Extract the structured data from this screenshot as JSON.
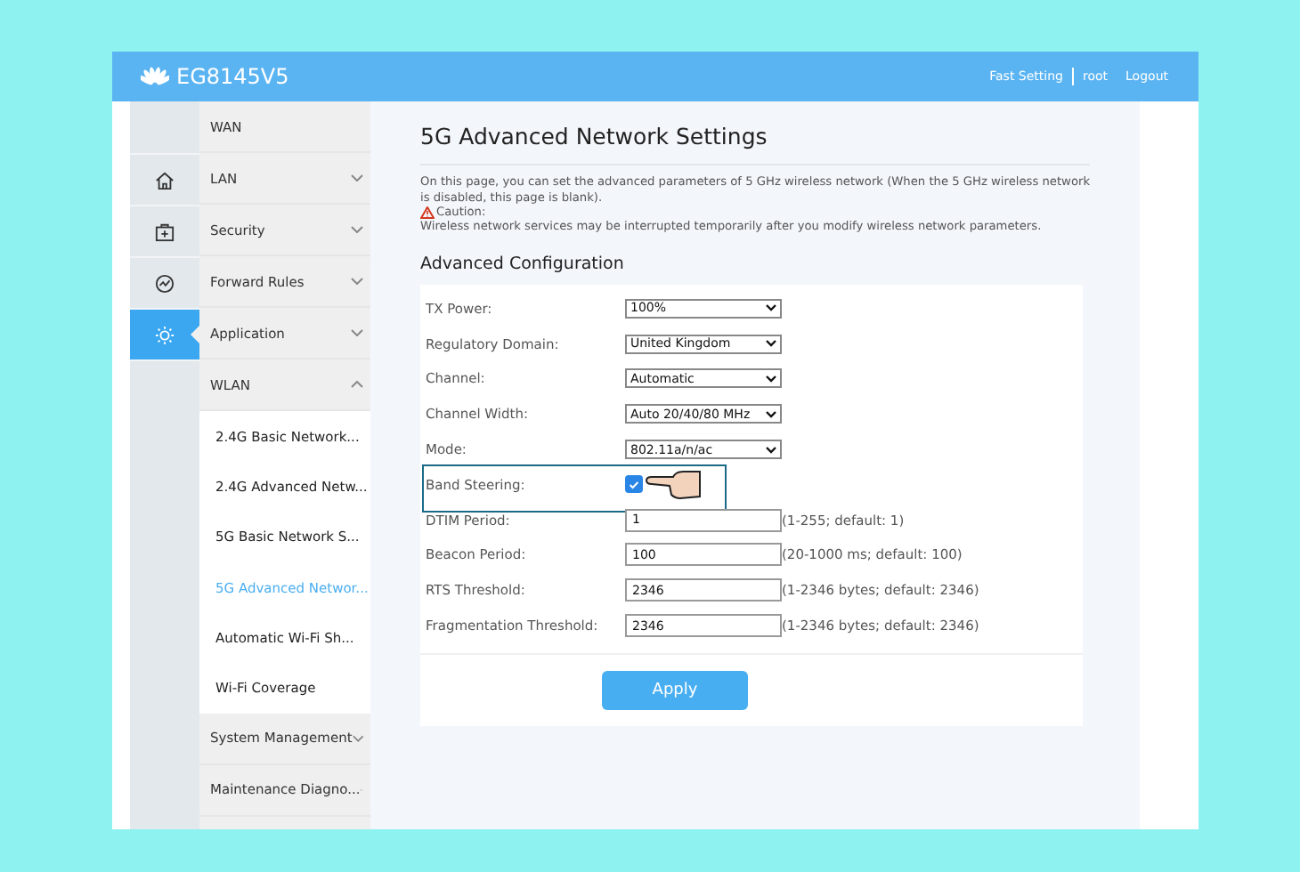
{
  "header": {
    "logo_text": "EG8145V5",
    "links": [
      "Fast Setting",
      "root",
      "Logout"
    ]
  },
  "rail": [
    {
      "kind": "blank",
      "selected": false
    },
    {
      "kind": "home",
      "selected": false
    },
    {
      "kind": "medkit",
      "selected": false
    },
    {
      "kind": "gauge",
      "selected": false
    },
    {
      "kind": "gear",
      "selected": true
    }
  ],
  "menu": [
    {
      "label": "WAN"
    },
    {
      "label": "LAN",
      "expanded": false
    },
    {
      "label": "Security",
      "expanded": false
    },
    {
      "label": "Forward Rules",
      "expanded": false
    },
    {
      "label": "Application",
      "expanded": false
    },
    {
      "label": "WLAN",
      "expanded": true,
      "children": [
        {
          "label": "2.4G Basic Network...",
          "selected": false
        },
        {
          "label": "2.4G Advanced Netw...",
          "selected": false
        },
        {
          "label": "5G Basic Network S...",
          "selected": false
        },
        {
          "label": "5G Advanced Networ...",
          "selected": true
        },
        {
          "label": "Automatic Wi-Fi Sh...",
          "selected": false
        },
        {
          "label": "Wi-Fi Coverage",
          "selected": false
        }
      ]
    },
    {
      "label": "System Management",
      "expanded": false
    },
    {
      "label": "Maintenance Diagno...",
      "expanded": false
    }
  ],
  "page": {
    "title": "5G Advanced Network Settings",
    "intro": "On this page, you can set the advanced parameters of 5 GHz wireless network (When the 5 GHz wireless network is disabled, this page is blank).",
    "caution_label": "Caution:",
    "caution_text": "Wireless network services may be interrupted temporarily after you modify wireless network parameters.",
    "section": "Advanced Configuration",
    "fields": [
      {
        "kind": "select",
        "label": "TX Power:",
        "value": "100%"
      },
      {
        "kind": "select",
        "label": "Regulatory Domain:",
        "value": "United Kingdom"
      },
      {
        "kind": "select",
        "label": "Channel:",
        "value": "Automatic"
      },
      {
        "kind": "select",
        "label": "Channel Width:",
        "value": "Auto 20/40/80 MHz"
      },
      {
        "kind": "select",
        "label": "Mode:",
        "value": "802.11a/n/ac"
      },
      {
        "kind": "checkbox",
        "label": "Band Steering:",
        "checked": true,
        "highlighted": true
      },
      {
        "kind": "input",
        "label": "DTIM Period:",
        "value": "1",
        "hint": "(1-255; default: 1)"
      },
      {
        "kind": "input",
        "label": "Beacon Period:",
        "value": "100",
        "hint": "(20-1000 ms; default: 100)"
      },
      {
        "kind": "input",
        "label": "RTS Threshold:",
        "value": "2346",
        "hint": "(1-2346 bytes; default: 2346)"
      },
      {
        "kind": "input",
        "label": "Fragmentation Threshold:",
        "value": "2346",
        "hint": "(1-2346 bytes; default: 2346)"
      }
    ],
    "apply_button": "Apply"
  }
}
